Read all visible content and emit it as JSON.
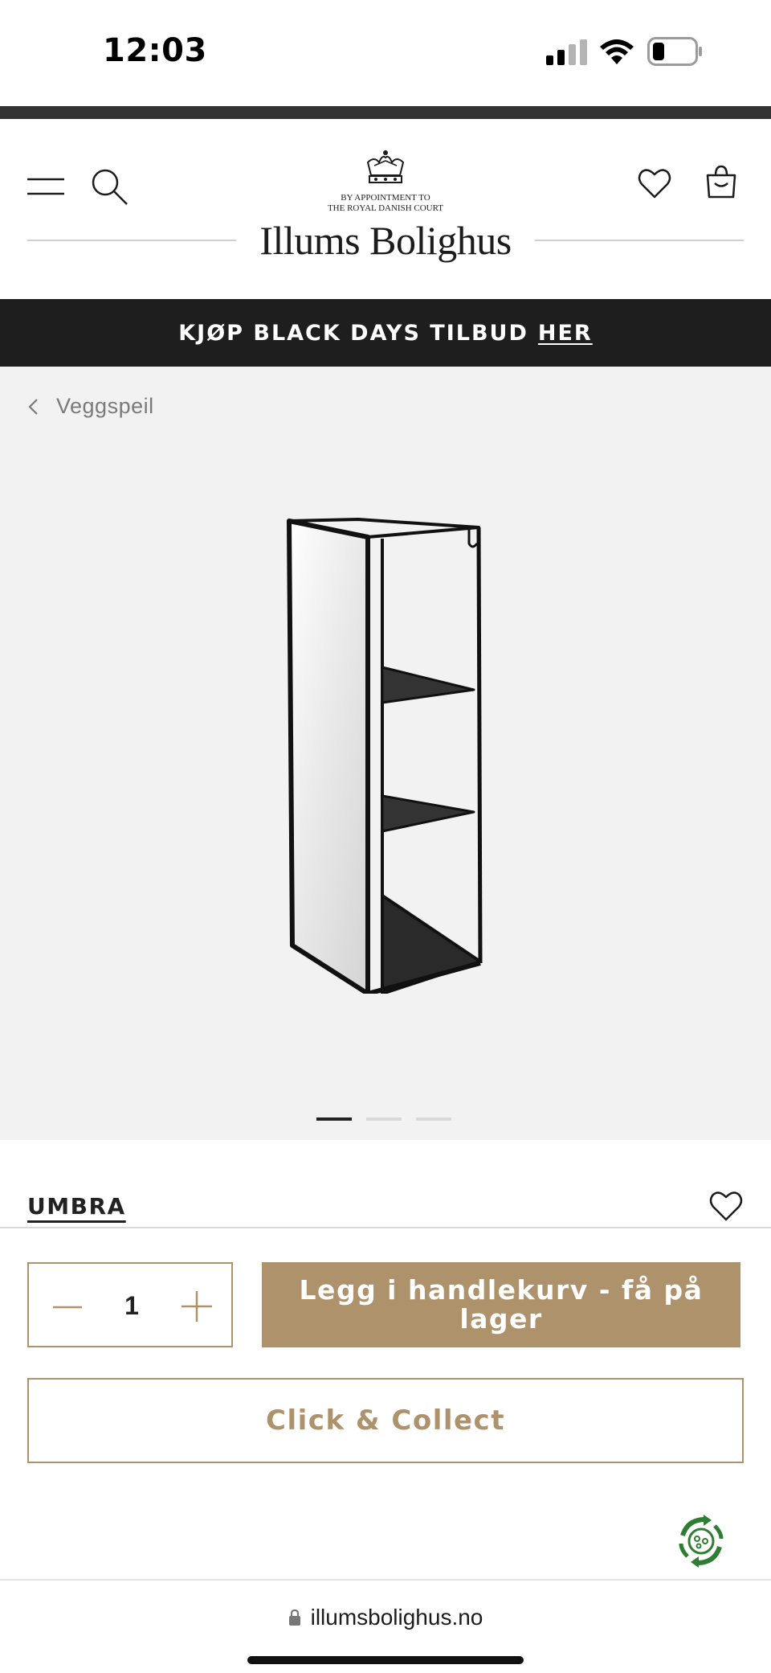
{
  "status_bar": {
    "time": "12:03"
  },
  "header": {
    "appointment_line1": "BY APPOINTMENT TO",
    "appointment_line2": "THE ROYAL DANISH COURT",
    "brand": "Illums Bolighus"
  },
  "promo": {
    "text": "KJØP BLACK DAYS TILBUD",
    "link": "HER"
  },
  "breadcrumb": {
    "label": "Veggspeil"
  },
  "gallery": {
    "slide_count": 3,
    "active_slide": 1
  },
  "product": {
    "brand": "UMBRA"
  },
  "purchase": {
    "quantity": "1",
    "add_to_cart_label": "Legg i handlekurv - få på lager",
    "click_collect_label": "Click & Collect"
  },
  "browser": {
    "url": "illumsbolighus.no"
  },
  "colors": {
    "accent": "#ad926c",
    "banner": "#1e1e1e",
    "gallery_bg": "#f2f2f2"
  },
  "icons": [
    "menu-icon",
    "search-icon",
    "heart-icon",
    "shopping-bag-icon",
    "crown-icon",
    "chevron-left-icon",
    "minus-icon",
    "plus-icon",
    "recycle-icon",
    "lock-icon"
  ]
}
